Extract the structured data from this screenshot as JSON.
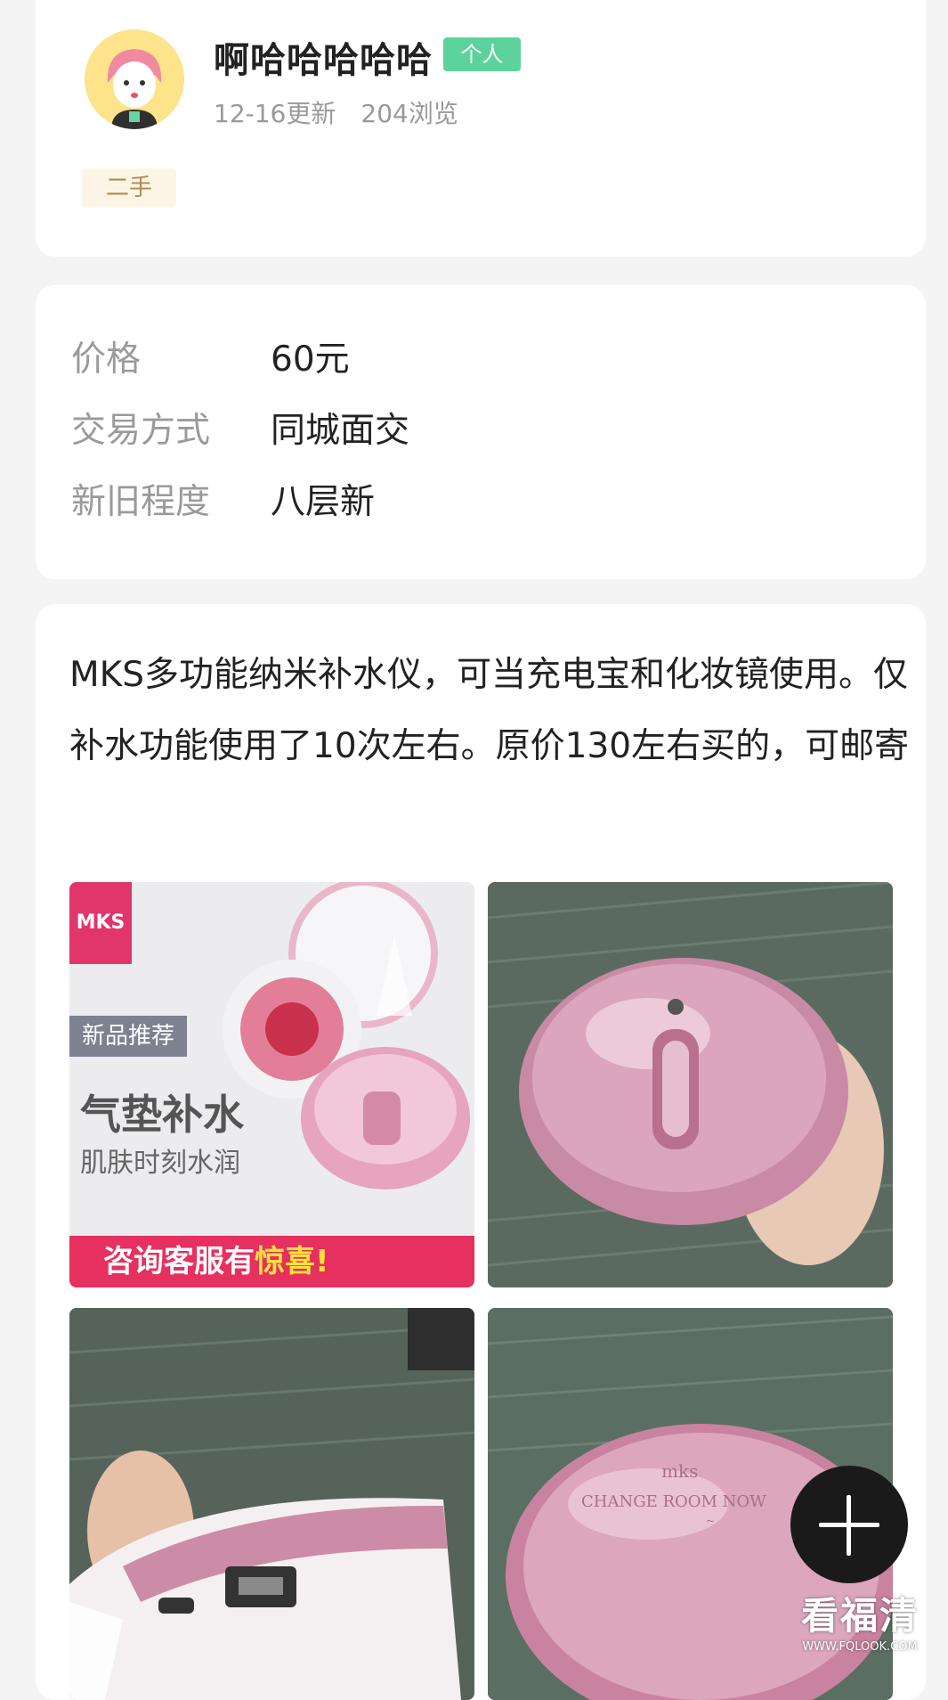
{
  "user": {
    "name": "啊哈哈哈哈哈",
    "badge": "个人",
    "updated": "12-16更新",
    "views": "204浏览",
    "tag": "二手"
  },
  "info": {
    "price_label": "价格",
    "price_value": "60元",
    "trade_label": "交易方式",
    "trade_value": "同城面交",
    "condition_label": "新旧程度",
    "condition_value": "八层新"
  },
  "description": "MKS多功能纳米补水仪，可当充电宝和化妆镜使用。仅补水功能使用了10次左右。原价130左右买的，可邮寄",
  "photo1": {
    "logo": "MKS",
    "tag": "新品推荐",
    "title": "气垫补水",
    "subtitle": "肌肤时刻水润",
    "banner_prefix": "咨询客服有",
    "banner_highlight": "惊喜!"
  },
  "photo4_engraving": "CHANGE ROOM NOW",
  "watermark": {
    "main": "看福清",
    "sub": "WWW.FQLOOK.COM"
  },
  "colors": {
    "badge": "#5cd39c",
    "tag_bg": "#fcf5e5",
    "banner": "#e6305f",
    "device_pink": "#d89ab6"
  },
  "icons": {
    "fab": "plus-icon"
  }
}
